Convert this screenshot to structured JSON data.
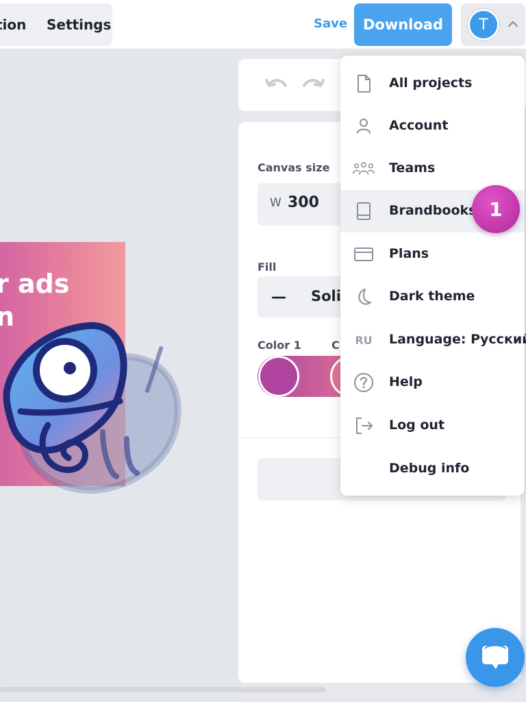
{
  "header": {
    "tabs": [
      {
        "label": "tion"
      },
      {
        "label": "Settings"
      }
    ],
    "save_label": "Save",
    "download_label": "Download",
    "avatar_initial": "T"
  },
  "canvas": {
    "text_line1": "r ads",
    "text_line2": "n"
  },
  "properties": {
    "canvas_size_label": "Canvas size",
    "width_prefix": "W",
    "width_value": "300",
    "fill_label": "Fill",
    "fill_dash": "—",
    "fill_value": "Solic",
    "color1_label": "Color 1",
    "color2_label": "C"
  },
  "menu": {
    "items": [
      {
        "label": "All projects",
        "icon": "file-icon"
      },
      {
        "label": "Account",
        "icon": "user-icon"
      },
      {
        "label": "Teams",
        "icon": "team-icon"
      },
      {
        "label": "Brandbooks",
        "icon": "book-icon"
      },
      {
        "label": "Plans",
        "icon": "card-icon"
      },
      {
        "label": "Dark theme",
        "icon": "moon-icon"
      },
      {
        "label": "Language: Русский",
        "icon_text": "RU"
      },
      {
        "label": "Help",
        "icon": "question-icon"
      },
      {
        "label": "Log out",
        "icon": "logout-icon"
      },
      {
        "label": "Debug info",
        "icon": ""
      }
    ],
    "badge_number": "1"
  },
  "colors": {
    "accent": "#3d9be9",
    "badge": "#c23aae",
    "swatch1": "#b0449e",
    "swatch2": "#de7595"
  }
}
